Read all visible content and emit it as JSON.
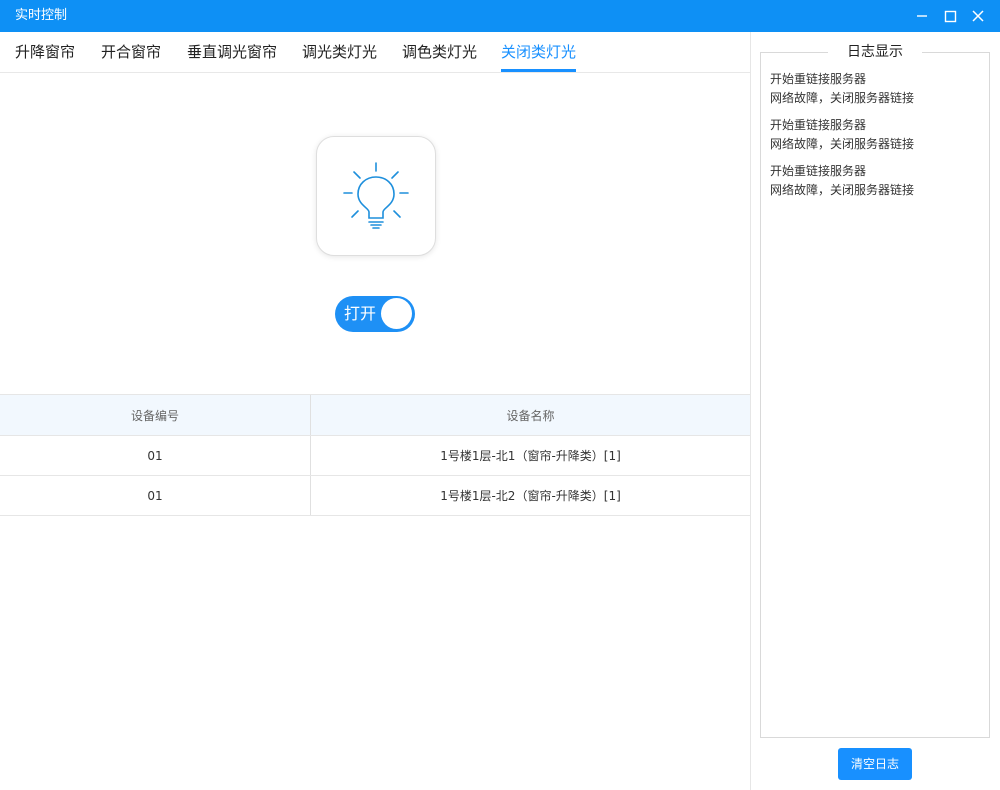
{
  "window": {
    "title": "实时控制",
    "controls": [
      "minimize-icon",
      "maximize-icon",
      "close-icon"
    ],
    "titlebar_color": "#0e90f5"
  },
  "tabs": [
    {
      "label": "升降窗帘",
      "active": false
    },
    {
      "label": "开合窗帘",
      "active": false
    },
    {
      "label": "垂直调光窗帘",
      "active": false
    },
    {
      "label": "调光类灯光",
      "active": false
    },
    {
      "label": "调色类灯光",
      "active": false
    },
    {
      "label": "关闭类灯光",
      "active": true
    }
  ],
  "device_icon": {
    "name": "lightbulb-icon",
    "color": "#1e8fdc"
  },
  "toggle": {
    "label": "打开",
    "state": "on",
    "color": "#1e90f5"
  },
  "table": {
    "headers": [
      "设备编号",
      "设备名称"
    ],
    "rows": [
      [
        "01",
        "1号楼1层-北1（窗帘-升降类）[1]"
      ],
      [
        "01",
        "1号楼1层-北2（窗帘-升降类）[1]"
      ]
    ]
  },
  "log": {
    "title": "日志显示",
    "entries": [
      [
        "开始重链接服务器",
        "网络故障，关闭服务器链接"
      ],
      [
        "开始重链接服务器",
        "网络故障，关闭服务器链接"
      ],
      [
        "开始重链接服务器",
        "网络故障，关闭服务器链接"
      ]
    ],
    "clear_label": "清空日志"
  },
  "accent_color": "#1890ff"
}
